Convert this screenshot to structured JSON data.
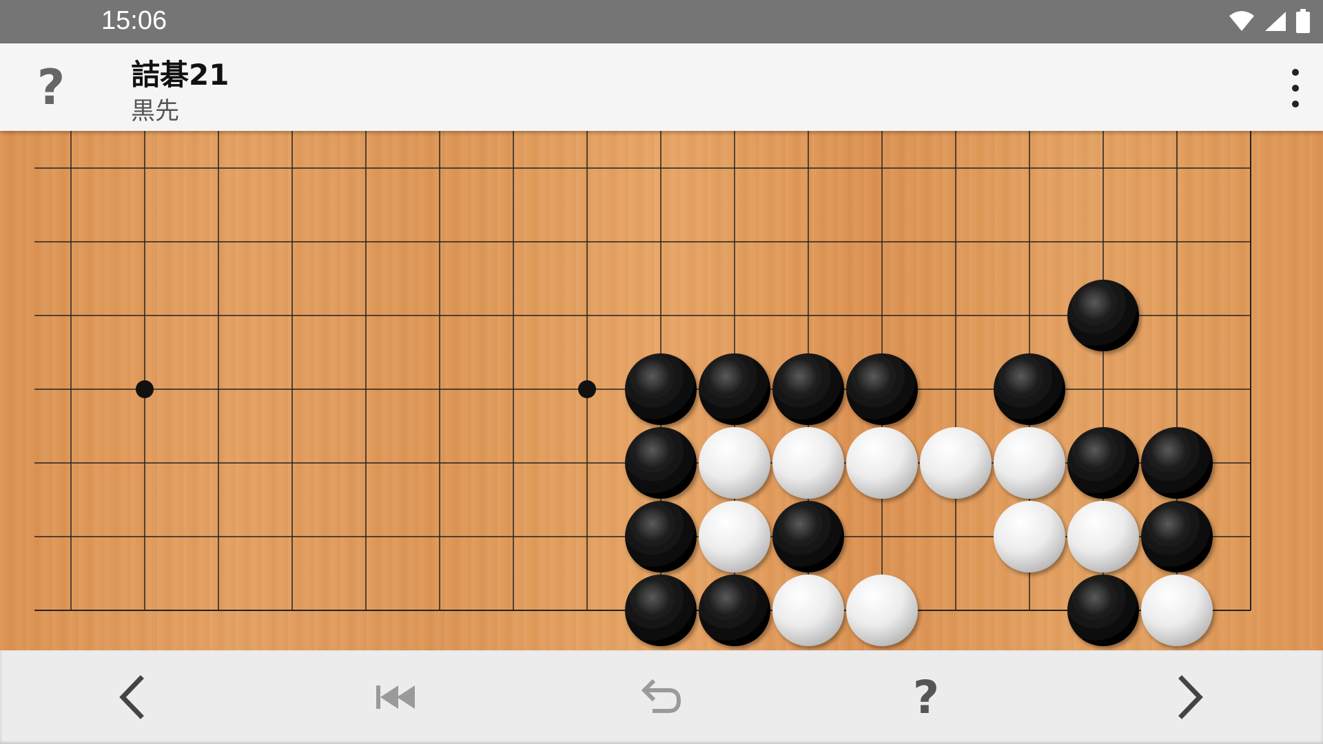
{
  "status_bar": {
    "time": "15:06",
    "icons": [
      "wifi-icon",
      "cellular-signal-icon",
      "battery-icon"
    ]
  },
  "app_bar": {
    "left_icon": "help-icon",
    "left_icon_glyph": "?",
    "title": "詰碁21",
    "subtitle": "黒先",
    "menu_icon": "more-vert-icon"
  },
  "board": {
    "columns": 17,
    "rows": 7,
    "star_points": [
      [
        1,
        3
      ],
      [
        7,
        3
      ]
    ],
    "stones": [
      {
        "color": "black",
        "col": 14,
        "row": 2
      },
      {
        "color": "black",
        "col": 8,
        "row": 3
      },
      {
        "color": "black",
        "col": 9,
        "row": 3
      },
      {
        "color": "black",
        "col": 10,
        "row": 3
      },
      {
        "color": "black",
        "col": 11,
        "row": 3
      },
      {
        "color": "black",
        "col": 13,
        "row": 3
      },
      {
        "color": "black",
        "col": 8,
        "row": 4
      },
      {
        "color": "white",
        "col": 9,
        "row": 4
      },
      {
        "color": "white",
        "col": 10,
        "row": 4
      },
      {
        "color": "white",
        "col": 11,
        "row": 4
      },
      {
        "color": "white",
        "col": 12,
        "row": 4
      },
      {
        "color": "white",
        "col": 13,
        "row": 4
      },
      {
        "color": "black",
        "col": 14,
        "row": 4
      },
      {
        "color": "black",
        "col": 15,
        "row": 4
      },
      {
        "color": "black",
        "col": 8,
        "row": 5
      },
      {
        "color": "white",
        "col": 9,
        "row": 5
      },
      {
        "color": "black",
        "col": 10,
        "row": 5
      },
      {
        "color": "white",
        "col": 13,
        "row": 5
      },
      {
        "color": "white",
        "col": 14,
        "row": 5
      },
      {
        "color": "black",
        "col": 15,
        "row": 5
      },
      {
        "color": "black",
        "col": 8,
        "row": 6
      },
      {
        "color": "black",
        "col": 9,
        "row": 6
      },
      {
        "color": "white",
        "col": 10,
        "row": 6
      },
      {
        "color": "white",
        "col": 11,
        "row": 6
      },
      {
        "color": "black",
        "col": 14,
        "row": 6
      },
      {
        "color": "white",
        "col": 15,
        "row": 6
      }
    ],
    "colors": {
      "line": "#222222",
      "black_stone": "#111111",
      "white_stone": "#f2f2f2"
    }
  },
  "bottom_nav": {
    "buttons": [
      {
        "name": "prev-button",
        "icon": "chevron-left-icon"
      },
      {
        "name": "first-move-button",
        "icon": "skip-to-start-icon"
      },
      {
        "name": "undo-button",
        "icon": "undo-icon"
      },
      {
        "name": "hint-button",
        "icon": "help-icon",
        "glyph": "?"
      },
      {
        "name": "next-button",
        "icon": "chevron-right-icon"
      }
    ]
  }
}
